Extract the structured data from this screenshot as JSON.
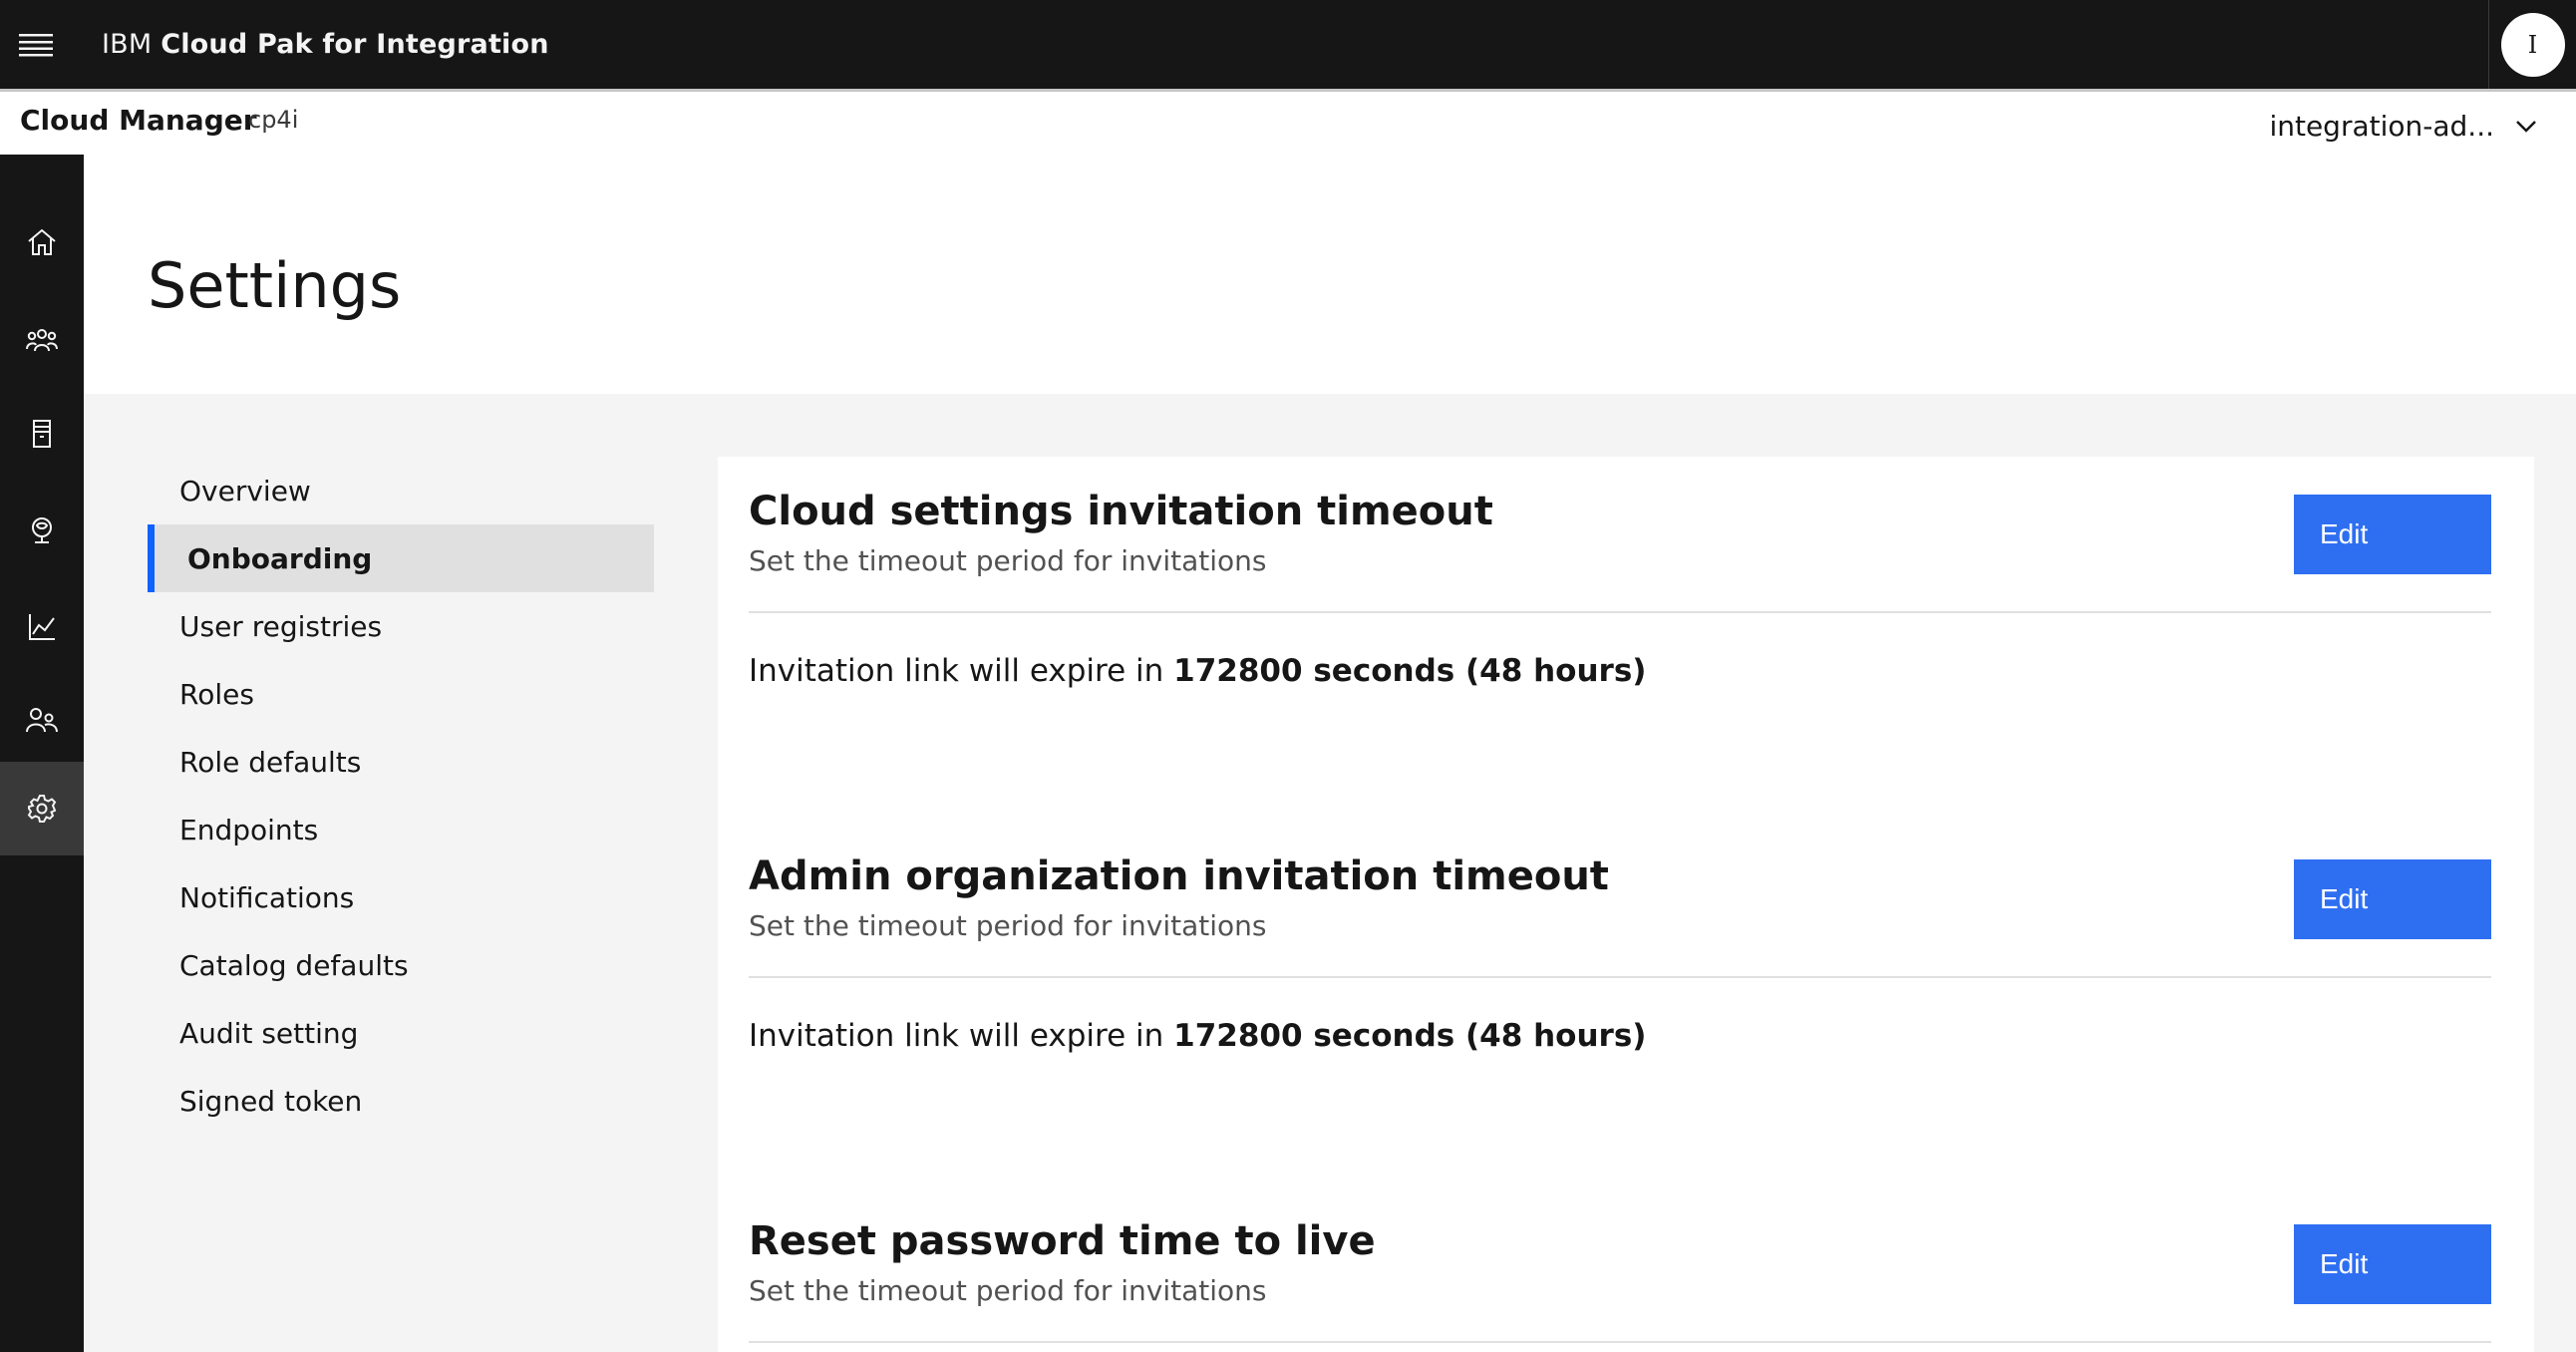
{
  "header": {
    "brand_prefix": "IBM",
    "brand_name": "Cloud Pak for Integration",
    "avatar_initial": "I"
  },
  "subheader": {
    "title": "Cloud Manager",
    "instance": "cp4i",
    "user": "integration-ad..."
  },
  "rail": {
    "items": [
      {
        "icon": "home-icon",
        "active": false
      },
      {
        "icon": "members-icon",
        "active": false
      },
      {
        "icon": "resources-icon",
        "active": false
      },
      {
        "icon": "topology-icon",
        "active": false
      },
      {
        "icon": "analytics-icon",
        "active": false
      },
      {
        "icon": "users-icon",
        "active": false
      },
      {
        "icon": "settings-icon",
        "active": true
      }
    ]
  },
  "page": {
    "title": "Settings"
  },
  "settings_nav": {
    "items": [
      {
        "label": "Overview",
        "active": false
      },
      {
        "label": "Onboarding",
        "active": true
      },
      {
        "label": "User registries",
        "active": false
      },
      {
        "label": "Roles",
        "active": false
      },
      {
        "label": "Role defaults",
        "active": false
      },
      {
        "label": "Endpoints",
        "active": false
      },
      {
        "label": "Notifications",
        "active": false
      },
      {
        "label": "Catalog defaults",
        "active": false
      },
      {
        "label": "Audit setting",
        "active": false
      },
      {
        "label": "Signed token",
        "active": false
      }
    ]
  },
  "sections": [
    {
      "title": "Cloud settings invitation timeout",
      "description": "Set the timeout period for invitations",
      "edit_label": "Edit",
      "body_prefix": "Invitation link will expire in ",
      "body_value": "172800 seconds (48 hours)"
    },
    {
      "title": "Admin organization invitation timeout",
      "description": "Set the timeout period for invitations",
      "edit_label": "Edit",
      "body_prefix": "Invitation link will expire in ",
      "body_value": "172800 seconds (48 hours)"
    },
    {
      "title": "Reset password time to live",
      "description": "Set the timeout period for invitations",
      "edit_label": "Edit",
      "body_prefix": "",
      "body_value": ""
    }
  ],
  "colors": {
    "primary_button": "#2e6ff2",
    "active_indicator": "#0f62fe",
    "header_bg": "#161616"
  }
}
